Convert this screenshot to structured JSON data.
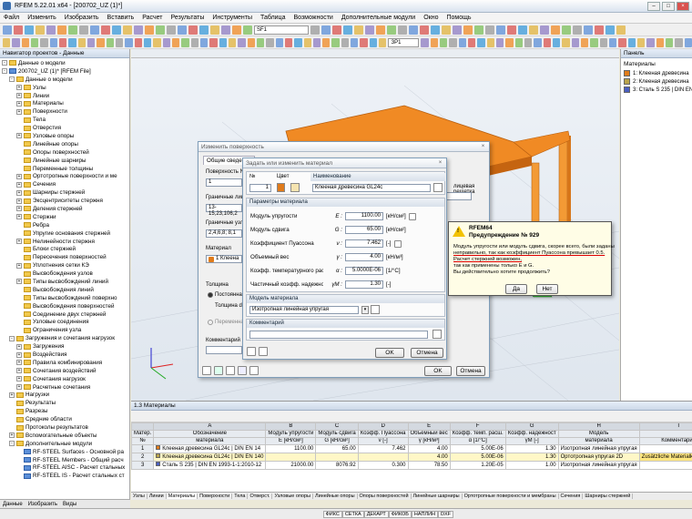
{
  "window": {
    "title": "RFEM 5.22.01 x64 - [200702_UZ (1)*]"
  },
  "menu": [
    "Файл",
    "Изменить",
    "Изобразить",
    "Вставить",
    "Расчет",
    "Результаты",
    "Инструменты",
    "Таблица",
    "Возможности",
    "Дополнительные модули",
    "Окно",
    "Помощь"
  ],
  "toolbar": {
    "combo1": "SF1",
    "combo2": "ЗР1"
  },
  "nav": {
    "title": "Навигатор проектов - Данные",
    "items": [
      {
        "t": "Данные о модели",
        "lvl": 0,
        "ex": "-",
        "ic": "f"
      },
      {
        "t": "200702_UZ (1)* [RFEM File]",
        "lvl": 0,
        "ex": "-",
        "ic": "b"
      },
      {
        "t": "Данные о модели",
        "lvl": 1,
        "ex": "-",
        "ic": "f"
      },
      {
        "t": "Узлы",
        "lvl": 2,
        "ex": "+",
        "ic": "f"
      },
      {
        "t": "Линии",
        "lvl": 2,
        "ex": "+",
        "ic": "f"
      },
      {
        "t": "Материалы",
        "lvl": 2,
        "ex": "+",
        "ic": "f"
      },
      {
        "t": "Поверхности",
        "lvl": 2,
        "ex": "+",
        "ic": "f"
      },
      {
        "t": "Тела",
        "lvl": 2,
        "ex": "",
        "ic": "f"
      },
      {
        "t": "Отверстия",
        "lvl": 2,
        "ex": "",
        "ic": "f"
      },
      {
        "t": "Узловые опоры",
        "lvl": 2,
        "ex": "+",
        "ic": "f"
      },
      {
        "t": "Линейные опоры",
        "lvl": 2,
        "ex": "",
        "ic": "f"
      },
      {
        "t": "Опоры поверхностей",
        "lvl": 2,
        "ex": "",
        "ic": "f"
      },
      {
        "t": "Линейные шарниры",
        "lvl": 2,
        "ex": "",
        "ic": "f"
      },
      {
        "t": "Переменные толщины",
        "lvl": 2,
        "ex": "",
        "ic": "f"
      },
      {
        "t": "Ортотропные поверхности и ме",
        "lvl": 2,
        "ex": "+",
        "ic": "f"
      },
      {
        "t": "Сечения",
        "lvl": 2,
        "ex": "+",
        "ic": "f"
      },
      {
        "t": "Шарниры стержней",
        "lvl": 2,
        "ex": "+",
        "ic": "f"
      },
      {
        "t": "Эксцентриситеты стержня",
        "lvl": 2,
        "ex": "+",
        "ic": "f"
      },
      {
        "t": "Деления стержней",
        "lvl": 2,
        "ex": "+",
        "ic": "f"
      },
      {
        "t": "Стержни",
        "lvl": 2,
        "ex": "+",
        "ic": "f"
      },
      {
        "t": "Ребра",
        "lvl": 2,
        "ex": "",
        "ic": "f"
      },
      {
        "t": "Упругие основания стержней",
        "lvl": 2,
        "ex": "",
        "ic": "f"
      },
      {
        "t": "Нелинейности стержня",
        "lvl": 2,
        "ex": "+",
        "ic": "f"
      },
      {
        "t": "Блоки стержней",
        "lvl": 2,
        "ex": "",
        "ic": "f"
      },
      {
        "t": "Пересечения поверхностей",
        "lvl": 2,
        "ex": "",
        "ic": "f"
      },
      {
        "t": "Уплотнения сетки КЭ",
        "lvl": 2,
        "ex": "+",
        "ic": "f"
      },
      {
        "t": "Высвобождения узлов",
        "lvl": 2,
        "ex": "",
        "ic": "f"
      },
      {
        "t": "Типы высвобождений линий",
        "lvl": 2,
        "ex": "+",
        "ic": "f"
      },
      {
        "t": "Высвобождения линий",
        "lvl": 2,
        "ex": "",
        "ic": "f"
      },
      {
        "t": "Типы высвобождений поверхно",
        "lvl": 2,
        "ex": "",
        "ic": "f"
      },
      {
        "t": "Высвобождения поверхностей",
        "lvl": 2,
        "ex": "",
        "ic": "f"
      },
      {
        "t": "Соединение двух стержней",
        "lvl": 2,
        "ex": "",
        "ic": "f"
      },
      {
        "t": "Узловые соединения",
        "lvl": 2,
        "ex": "",
        "ic": "f"
      },
      {
        "t": "Ограничения узла",
        "lvl": 2,
        "ex": "",
        "ic": "f"
      },
      {
        "t": "Загружения и сочетания нагрузок",
        "lvl": 1,
        "ex": "-",
        "ic": "f"
      },
      {
        "t": "Загружения",
        "lvl": 2,
        "ex": "+",
        "ic": "f"
      },
      {
        "t": "Воздействия",
        "lvl": 2,
        "ex": "+",
        "ic": "f"
      },
      {
        "t": "Правила комбинирования",
        "lvl": 2,
        "ex": "+",
        "ic": "f"
      },
      {
        "t": "Сочетания воздействий",
        "lvl": 2,
        "ex": "+",
        "ic": "f"
      },
      {
        "t": "Сочетания нагрузок",
        "lvl": 2,
        "ex": "+",
        "ic": "f"
      },
      {
        "t": "Расчетные сочетания",
        "lvl": 2,
        "ex": "+",
        "ic": "f"
      },
      {
        "t": "Нагрузки",
        "lvl": 1,
        "ex": "+",
        "ic": "f"
      },
      {
        "t": "Результаты",
        "lvl": 1,
        "ex": "",
        "ic": "f"
      },
      {
        "t": "Разрезы",
        "lvl": 1,
        "ex": "",
        "ic": "f"
      },
      {
        "t": "Средние области",
        "lvl": 1,
        "ex": "",
        "ic": "f"
      },
      {
        "t": "Протоколы результатов",
        "lvl": 1,
        "ex": "",
        "ic": "f"
      },
      {
        "t": "Вспомогательные объекты",
        "lvl": 1,
        "ex": "+",
        "ic": "f"
      },
      {
        "t": "Дополнительные модули",
        "lvl": 1,
        "ex": "-",
        "ic": "f"
      },
      {
        "t": "RF-STEEL Surfaces - Основной ра",
        "lvl": 2,
        "ex": "",
        "ic": "b"
      },
      {
        "t": "RF-STEEL Members - Общий расч",
        "lvl": 2,
        "ex": "",
        "ic": "b"
      },
      {
        "t": "RF-STEEL AISC - Расчет стальных",
        "lvl": 2,
        "ex": "",
        "ic": "b"
      },
      {
        "t": "RF-STEEL IS - Расчет стальных ст",
        "lvl": 2,
        "ex": "",
        "ic": "b"
      }
    ],
    "tabs": [
      "Данные",
      "Изобразить",
      "Виды"
    ]
  },
  "panel": {
    "title": "Панель",
    "section": "Материалы",
    "legend": [
      {
        "label": "1: Клееная древесина",
        "color": "#e07b1a"
      },
      {
        "label": "2: Клееная древесина",
        "color": "#b9a34a"
      },
      {
        "label": "3: Сталь S 235 | DIN EN",
        "color": "#4a5fc1"
      }
    ]
  },
  "surface_dialog": {
    "title": "Изменить поверхность",
    "tab_general": "Общие сведения",
    "lbl_surface_no": "Поверхность N",
    "surface_no": "1",
    "lbl_boundary": "Граничные лини",
    "boundary": "13-15,23,106,2",
    "lbl_nodes": "Граничные узлы",
    "nodes": "2,4,6,8; 8,1",
    "lbl_material": "Материал",
    "material": "1  Клеена",
    "lbl_thickness": "Толщина",
    "opt_const": "Постоянная",
    "lbl_d": "Толщина d:",
    "opt_var": "Переменная",
    "lbl_comment": "Комментарий",
    "right_label": "лицевая решетка",
    "ok": "OK",
    "cancel": "Отмена"
  },
  "material_dialog": {
    "title": "Задать или изменить материал",
    "lbl_no": "№",
    "lbl_color": "Цвет",
    "lbl_name": "Наименование",
    "no": "1",
    "name": "Клееная древесина GL24c",
    "params_title": "Параметры материала",
    "params": [
      {
        "label": "Модуль упругости",
        "sym": "E :",
        "val": "1100.00",
        "unit": "[кН/см²]"
      },
      {
        "label": "Модуль сдвига",
        "sym": "G :",
        "val": "65.00",
        "unit": "[кН/см²]"
      },
      {
        "label": "Коэффициент Пуассона",
        "sym": "ν :",
        "val": "7.462",
        "unit": "[-]"
      },
      {
        "label": "Объемный вес",
        "sym": "γ :",
        "val": "4.00",
        "unit": "[кН/м³]"
      },
      {
        "label": "Коэфф. температурного расширения",
        "sym": "α :",
        "val": "5.0000E-06",
        "unit": "[1/°C]"
      },
      {
        "label": "Частичный коэфф. надежности",
        "sym": "γM :",
        "val": "1.30",
        "unit": "[-]"
      }
    ],
    "model_title": "Модель материала",
    "model": "Изотропная линейная упругая",
    "comment_title": "Комментарий",
    "ok": "OK",
    "cancel": "Отмена"
  },
  "warning": {
    "title": "RFEM64",
    "subtitle": "Предупреждение № 929",
    "line1": "Модуль упругости или модуль сдвига, скорее всего, были заданы",
    "line2": "неправильно, так как коэффициент Пуассона превышает 0.5.",
    "line3": "Расчет стержней возможен,",
    "line4": "так как применены только E и G.",
    "line5": "Вы действительно хотите продолжить?",
    "yes": "Да",
    "no": "Нет"
  },
  "table": {
    "title": "1.3 Материалы",
    "cols": [
      "A",
      "B",
      "C",
      "D",
      "E",
      "F",
      "G",
      "H",
      "I"
    ],
    "headers": [
      [
        "Матер.",
        "№"
      ],
      [
        "Обозначение",
        "материала"
      ],
      [
        "Модуль упругости",
        "E [кН/см²]"
      ],
      [
        "Модуль сдвига",
        "G [кН/см²]"
      ],
      [
        "Коэфф. Пуассона",
        "ν [-]"
      ],
      [
        "Объемный вес",
        "γ [кН/м³]"
      ],
      [
        "Коэфф. темп. расш.",
        "α [1/°C]"
      ],
      [
        "Коэфф. надежност",
        "γM [-]"
      ],
      [
        "Модель",
        "материала"
      ],
      [
        "",
        "Комментарий"
      ]
    ],
    "rows": [
      [
        "1",
        "Клееная древесина GL24c | DIN EN 14",
        "1100.00",
        "65.00",
        "7.462",
        "4.00",
        "5.00E-06",
        "1.30",
        "Изотропная линейная упругая",
        ""
      ],
      [
        "2",
        "Клееная древесина GL24c | DIN EN 140",
        "",
        "",
        "",
        "4.00",
        "5.00E-06",
        "1.30",
        "Ортотропная упругая 2D",
        "Zusätzliche Materialkennwerte"
      ],
      [
        "3",
        "Сталь S 235 | DIN EN 1993-1-1:2010-12",
        "21000.00",
        "8076.92",
        "0.300",
        "78.50",
        "1.20E-05",
        "1.00",
        "Изотропная линейная упругая",
        ""
      ]
    ]
  },
  "bottom_tabs": [
    "Узлы",
    "Линии",
    "Материалы",
    "Поверхности",
    "Тела",
    "Отверст.",
    "Узловые опоры",
    "Линейные опоры",
    "Опоры поверхностей",
    "Линейные шарниры",
    "Ортотропные поверхности и мембраны",
    "Сечения",
    "Шарниры стержней"
  ],
  "status": [
    "ФИКС",
    "СЕТКА",
    "ДЕКАРТ",
    "ФИКОБ",
    "НАПЛИН",
    "DXF"
  ]
}
